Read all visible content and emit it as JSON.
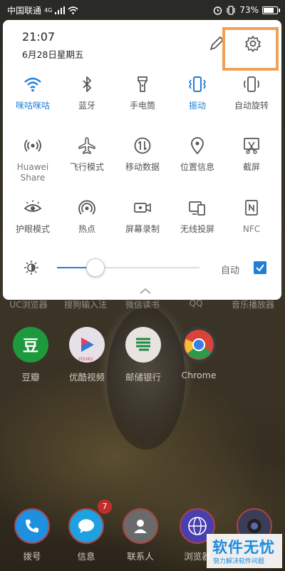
{
  "status_bar": {
    "carrier": "中国联通",
    "network": "4G",
    "battery": "73%"
  },
  "panel": {
    "time": "21:07",
    "date": "6月28日星期五",
    "tiles": [
      {
        "label": "咪咕咪咕",
        "icon": "wifi-icon",
        "active": true
      },
      {
        "label": "蓝牙",
        "icon": "bluetooth-icon",
        "active": false
      },
      {
        "label": "手电筒",
        "icon": "flashlight-icon",
        "active": false
      },
      {
        "label": "振动",
        "icon": "vibrate-icon",
        "active": true
      },
      {
        "label": "自动旋转",
        "icon": "rotate-icon",
        "active": false
      },
      {
        "label": "Huawei\nShare",
        "icon": "huawei-share-icon",
        "active": false
      },
      {
        "label": "飞行模式",
        "icon": "airplane-icon",
        "active": false
      },
      {
        "label": "移动数据",
        "icon": "mobile-data-icon",
        "active": false
      },
      {
        "label": "位置信息",
        "icon": "location-icon",
        "active": false
      },
      {
        "label": "截屏",
        "icon": "screenshot-icon",
        "active": false
      },
      {
        "label": "护眼模式",
        "icon": "eye-comfort-icon",
        "active": false
      },
      {
        "label": "热点",
        "icon": "hotspot-icon",
        "active": false
      },
      {
        "label": "屏幕录制",
        "icon": "screen-record-icon",
        "active": false
      },
      {
        "label": "无线投屏",
        "icon": "wireless-projection-icon",
        "active": false
      },
      {
        "label": "NFC",
        "icon": "nfc-icon",
        "active": false
      }
    ],
    "brightness": {
      "level": 0.27,
      "auto_label": "自动",
      "auto_checked": true
    },
    "accent": "#1f7fd4",
    "highlight_color": "#f0a058"
  },
  "home": {
    "folders": [
      "UC浏览器",
      "搜狗输入法",
      "微信读书",
      "QQ",
      "音乐播放器"
    ],
    "apps": [
      {
        "label": "豆瓣",
        "icon": "douban-icon"
      },
      {
        "label": "优酷视频",
        "icon": "youku-icon"
      },
      {
        "label": "邮储银行",
        "icon": "postal-bank-icon"
      },
      {
        "label": "Chrome",
        "icon": "chrome-icon"
      }
    ],
    "dock": [
      {
        "label": "拨号",
        "icon": "phone-icon"
      },
      {
        "label": "信息",
        "icon": "messages-icon",
        "badge": "7"
      },
      {
        "label": "联系人",
        "icon": "contacts-icon"
      },
      {
        "label": "浏览器",
        "icon": "browser-icon"
      },
      {
        "label": "",
        "icon": "camera-icon"
      }
    ],
    "youku_tag": "YOUKU"
  },
  "watermark": {
    "main": "软件无忧",
    "sub": "努力解决软件问题"
  }
}
